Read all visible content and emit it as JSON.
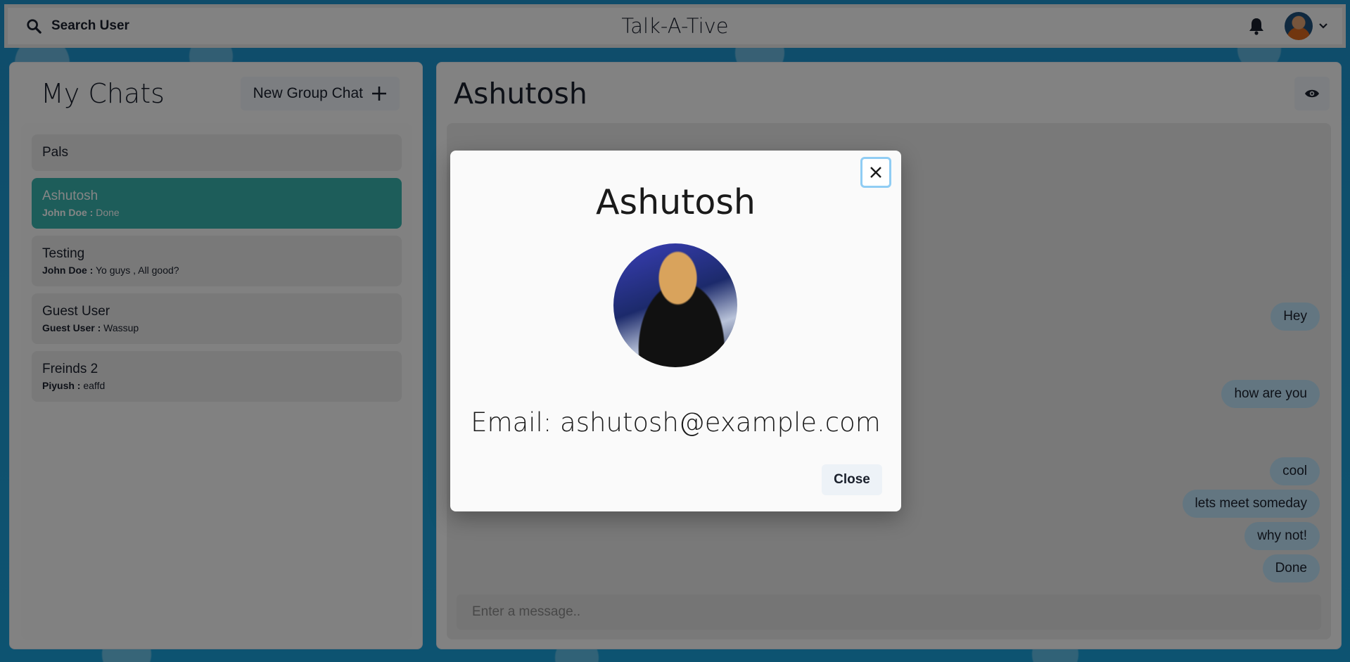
{
  "header": {
    "search_label": "Search User",
    "app_title": "Talk-A-Tive",
    "icons": [
      "search-icon",
      "bell-icon",
      "avatar",
      "chevron-down-icon"
    ]
  },
  "sidebar": {
    "title": "My Chats",
    "new_group_label": "New Group Chat",
    "chats": [
      {
        "name": "Pals",
        "sender": "",
        "preview": ""
      },
      {
        "name": "Ashutosh",
        "sender": "John Doe :",
        "preview": "Done",
        "active": true
      },
      {
        "name": "Testing",
        "sender": "John Doe :",
        "preview": "Yo guys , All good?"
      },
      {
        "name": "Guest User",
        "sender": "Guest User :",
        "preview": "Wassup"
      },
      {
        "name": "Freinds 2",
        "sender": "Piyush :",
        "preview": "eaffd"
      }
    ]
  },
  "conversation": {
    "title": "Ashutosh",
    "messages": [
      "Hey",
      "how are you",
      "cool",
      "lets meet someday",
      "why not!",
      "Done"
    ],
    "input_placeholder": "Enter a message.."
  },
  "modal": {
    "name": "Ashutosh",
    "email": "Email: ashutosh@example.com",
    "close_label": "Close"
  },
  "colors": {
    "accent": "#38b2ac",
    "bubble": "#bee3f8",
    "background": "#1f9ad3"
  }
}
